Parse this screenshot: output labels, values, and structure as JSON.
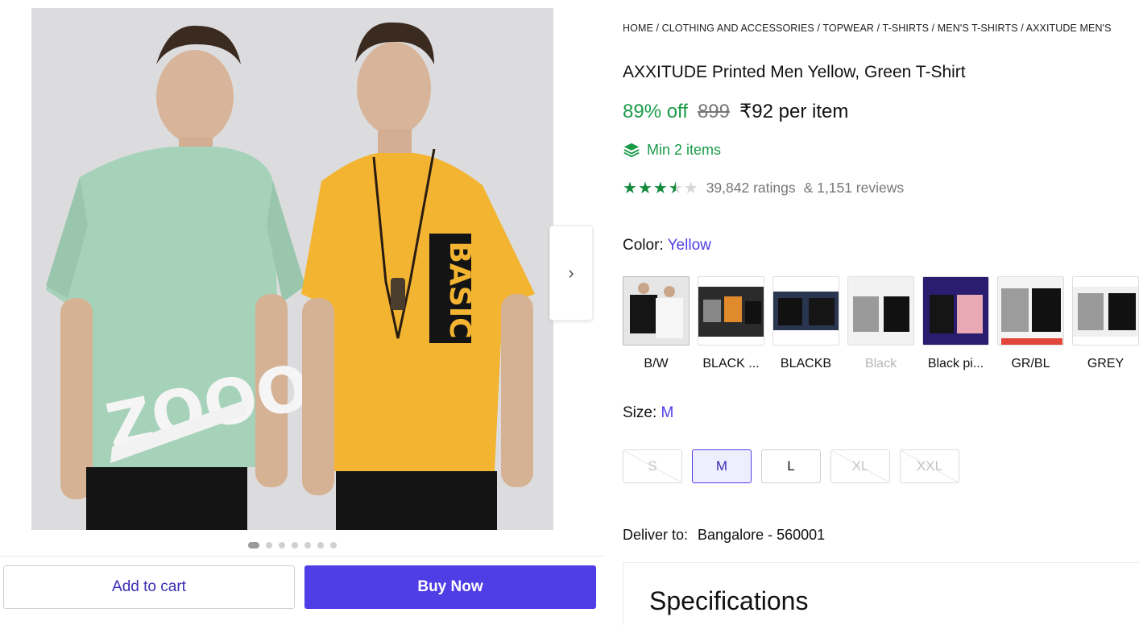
{
  "breadcrumb": "HOME / CLOTHING AND ACCESSORIES / TOPWEAR / T-SHIRTS / MEN'S T-SHIRTS / AXXITUDE MEN'S",
  "product": {
    "title": "AXXITUDE Printed Men Yellow, Green T-Shirt",
    "discount": "89% off",
    "mrp": "899",
    "price": "₹92 per item",
    "min_items": "Min 2 items",
    "rating": 3.5,
    "ratings_text": "39,842 ratings",
    "reviews_text": "& 1,151 reviews"
  },
  "image_graphics": {
    "left_print": "ZOOOO",
    "right_print": "BASIC"
  },
  "color": {
    "label": "Color:",
    "selected": "Yellow",
    "options": [
      {
        "label": "B/W",
        "disabled": false
      },
      {
        "label": "BLACK ...",
        "disabled": false
      },
      {
        "label": "BLACKB",
        "disabled": false
      },
      {
        "label": "Black",
        "disabled": true
      },
      {
        "label": "Black pi...",
        "disabled": false
      },
      {
        "label": "GR/BL",
        "disabled": false
      },
      {
        "label": "GREY",
        "disabled": false
      }
    ]
  },
  "size": {
    "label": "Size:",
    "selected": "M",
    "options": [
      {
        "label": "S",
        "disabled": true
      },
      {
        "label": "M",
        "disabled": false
      },
      {
        "label": "L",
        "disabled": false
      },
      {
        "label": "XL",
        "disabled": true
      },
      {
        "label": "XXL",
        "disabled": true
      }
    ]
  },
  "delivery": {
    "label": "Deliver to:",
    "location": "Bangalore - 560001"
  },
  "actions": {
    "add_to_cart": "Add to cart",
    "buy_now": "Buy Now"
  },
  "specifications_title": "Specifications",
  "gallery": {
    "dot_count": 7,
    "active_dot": 0
  },
  "colors": {
    "accent": "#4f3de6",
    "discount_green": "#1a9b49",
    "star_green": "#148a3d"
  }
}
